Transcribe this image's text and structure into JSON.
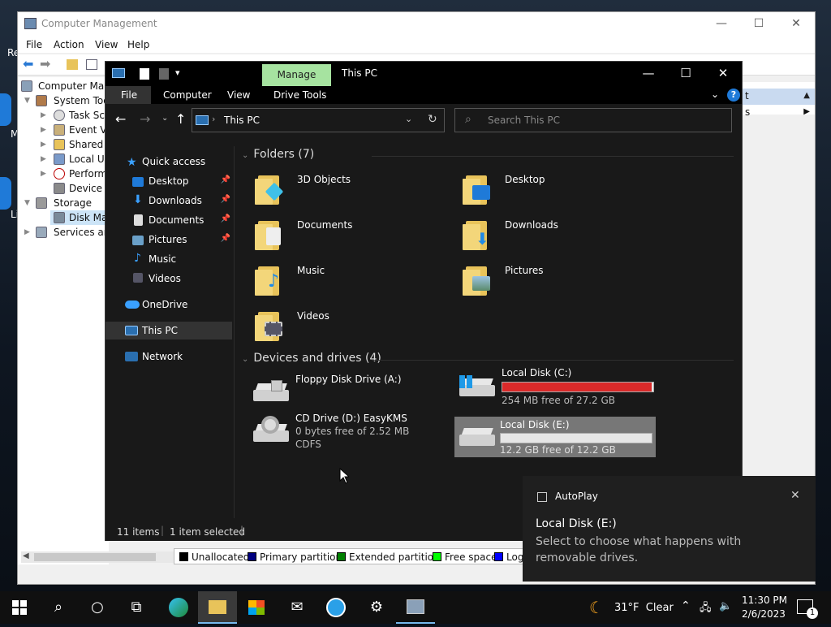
{
  "desktop": {
    "left_letters": [
      "Re",
      "M",
      "Li"
    ]
  },
  "cm": {
    "title": "Computer Management",
    "menu": [
      "File",
      "Action",
      "View",
      "Help"
    ],
    "tree": [
      {
        "label": "Computer Man",
        "level": 0
      },
      {
        "label": "System Tools",
        "level": 1
      },
      {
        "label": "Task Sch",
        "level": 2
      },
      {
        "label": "Event Vie",
        "level": 2
      },
      {
        "label": "Shared F",
        "level": 2
      },
      {
        "label": "Local Us",
        "level": 2
      },
      {
        "label": "Perform",
        "level": 2
      },
      {
        "label": "Device M",
        "level": 2
      },
      {
        "label": "Storage",
        "level": 1
      },
      {
        "label": "Disk Mar",
        "level": 2
      },
      {
        "label": "Services and",
        "level": 1
      }
    ],
    "actions_header": "t",
    "actions_item": "s",
    "legend": [
      {
        "label": "Unallocated",
        "color": "#000000"
      },
      {
        "label": "Primary partition",
        "color": "#000080"
      },
      {
        "label": "Extended partition",
        "color": "#008000"
      },
      {
        "label": "Free space",
        "color": "#00ff00"
      },
      {
        "label": "Log",
        "color": "#0000ff"
      }
    ]
  },
  "explorer": {
    "manage_tab": "Manage",
    "title": "This PC",
    "ribbon_tabs": [
      "File",
      "Computer",
      "View",
      "Drive Tools"
    ],
    "address": "This PC",
    "search_placeholder": "Search This PC",
    "nav": {
      "quick_access": "Quick access",
      "pinned": [
        "Desktop",
        "Downloads",
        "Documents",
        "Pictures"
      ],
      "unpinned": [
        "Music",
        "Videos"
      ],
      "onedrive": "OneDrive",
      "this_pc": "This PC",
      "network": "Network"
    },
    "folders_header": "Folders (7)",
    "folders": [
      "3D Objects",
      "Desktop",
      "Documents",
      "Downloads",
      "Music",
      "Pictures",
      "Videos"
    ],
    "drives_header": "Devices and drives (4)",
    "drives": [
      {
        "name": "Floppy Disk Drive (A:)"
      },
      {
        "name": "Local Disk (C:)",
        "free": "254 MB free of 27.2 GB",
        "used_fraction": 0.99,
        "bar_color": "#da2a2a"
      },
      {
        "name": "CD Drive (D:) EasyKMS",
        "free": "0 bytes free of 2.52 MB",
        "fs": "CDFS"
      },
      {
        "name": "Local Disk (E:)",
        "free": "12.2 GB free of 12.2 GB",
        "used_fraction": 0.0,
        "bar_color": "#26a0da"
      }
    ],
    "status": {
      "items": "11 items",
      "selected": "1 item selected"
    }
  },
  "toast": {
    "app": "AutoPlay",
    "title": "Local Disk (E:)",
    "body": "Select to choose what happens with removable drives."
  },
  "taskbar": {
    "weather": "31°F  Clear",
    "time": "11:30 PM",
    "date": "2/6/2023",
    "notif_count": "1"
  }
}
